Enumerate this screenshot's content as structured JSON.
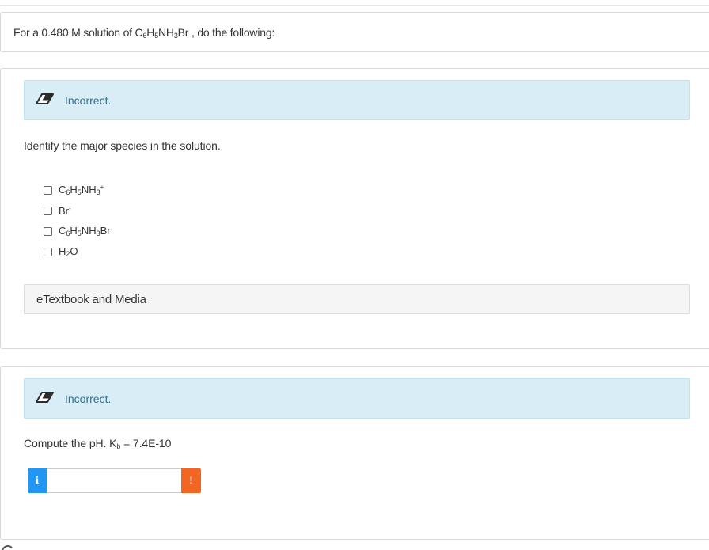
{
  "prompt": {
    "prefix": "For a 0.480 M solution of C",
    "s1": "6",
    "m1": "H",
    "s2": "5",
    "m2": "NH",
    "s3": "3",
    "suffix": "Br , do the following:"
  },
  "part1": {
    "feedback": "Incorrect.",
    "question": "Identify the major species in the solution.",
    "options": [
      {
        "parts": [
          "C",
          "6",
          "H",
          "5",
          "NH",
          "3",
          "+"
        ]
      },
      {
        "parts": [
          "Br",
          "-"
        ]
      },
      {
        "parts": [
          "C",
          "6",
          "H",
          "5",
          "NH",
          "3",
          "Br"
        ]
      },
      {
        "parts": [
          "H",
          "2",
          "O"
        ]
      }
    ],
    "etextbook": "eTextbook and Media"
  },
  "part2": {
    "feedback": "Incorrect.",
    "question_prefix": "Compute the pH. K",
    "question_sub": "b",
    "question_suffix": " = 7.4E-10",
    "answer_value": "",
    "info_glyph": "i",
    "warn_glyph": "!"
  },
  "icons": {
    "feedback": "eraser-icon",
    "info": "info-icon",
    "warning": "warning-icon"
  },
  "colors": {
    "feedback_bg": "#d9edf7",
    "feedback_text": "#31708f",
    "info_button": "#2196f3",
    "warning_button": "#f26522"
  }
}
